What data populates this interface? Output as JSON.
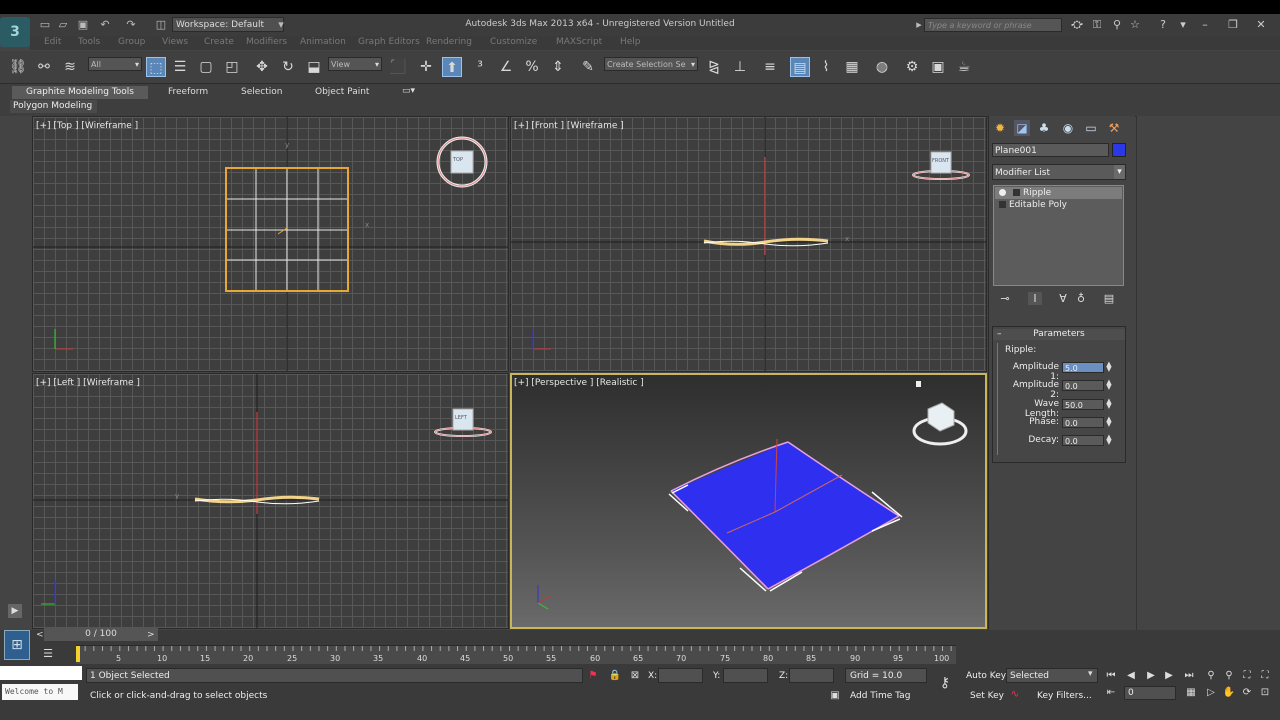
{
  "titlebar": {
    "workspace": "Workspace: Default",
    "title": "Autodesk 3ds Max  2013 x64    -   Unregistered Version    Untitled",
    "help_search_placeholder": "Type a keyword or phrase"
  },
  "menu": {
    "items": [
      "Edit",
      "Tools",
      "Group",
      "Views",
      "Create",
      "Modifiers",
      "Animation",
      "Graph Editors",
      "Rendering",
      "Customize",
      "MAXScript",
      "Help"
    ]
  },
  "toolbar": {
    "selection_filter": "All",
    "ref_coord": "View",
    "named_selection": "Create Selection Se"
  },
  "ribbon": {
    "tabs": [
      "Graphite Modeling Tools",
      "Freeform",
      "Selection",
      "Object Paint"
    ],
    "panel": "Polygon Modeling"
  },
  "viewports": {
    "top": {
      "label": "[+] [Top ] [Wireframe ]",
      "cube": "TOP"
    },
    "front": {
      "label": "[+] [Front ] [Wireframe ]",
      "cube": "FRONT"
    },
    "left": {
      "label": "[+] [Left ] [Wireframe ]",
      "cube": "LEFT"
    },
    "perspective": {
      "label": "[+] [Perspective ] [Realistic ]"
    }
  },
  "command_panel": {
    "object_name": "Plane001",
    "object_color": "#2b38e6",
    "modifier_list": "Modifier List",
    "stack": [
      "Ripple",
      "Editable Poly"
    ],
    "parameters": {
      "title": "Parameters",
      "group": "Ripple:",
      "fields": [
        {
          "label": "Amplitude 1:",
          "value": "5.0"
        },
        {
          "label": "Amplitude 2:",
          "value": "0.0"
        },
        {
          "label": "Wave Length:",
          "value": "50.0"
        },
        {
          "label": "Phase:",
          "value": "0.0"
        },
        {
          "label": "Decay:",
          "value": "0.0"
        }
      ]
    }
  },
  "timeline": {
    "frame": "0 / 100",
    "ticks": [
      "5",
      "10",
      "15",
      "20",
      "25",
      "30",
      "35",
      "40",
      "45",
      "50",
      "55",
      "60",
      "65",
      "70",
      "75",
      "80",
      "85",
      "90",
      "95",
      "100"
    ]
  },
  "status": {
    "welcome": "Welcome to M",
    "selected": "1 Object Selected",
    "prompt": "Click or click-and-drag to select objects",
    "x_label": "X:",
    "y_label": "Y:",
    "z_label": "Z:",
    "grid": "Grid = 10.0",
    "add_time_tag": "Add Time Tag",
    "auto_key": "Auto Key",
    "set_key": "Set Key",
    "key_filter_value": "Selected",
    "key_filters": "Key Filters...",
    "frame_field": "0"
  }
}
